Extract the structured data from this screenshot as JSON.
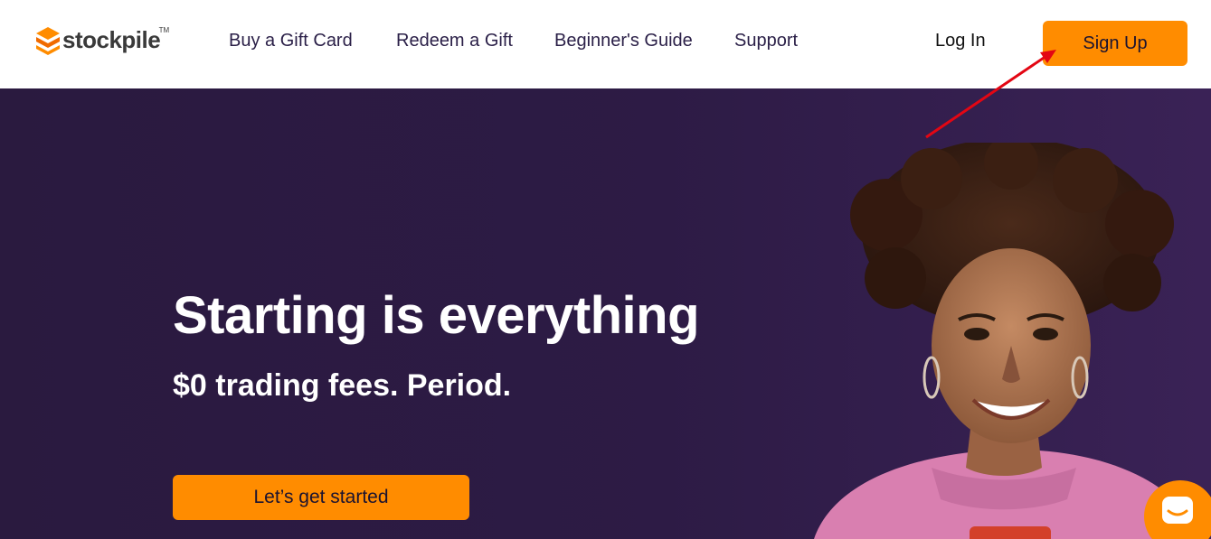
{
  "brand": {
    "name": "stockpile",
    "trademark": "TM",
    "accent_color": "#ff8c00",
    "hero_bg": "#2d1b45"
  },
  "nav": {
    "items": [
      {
        "label": "Buy a Gift Card"
      },
      {
        "label": "Redeem a Gift"
      },
      {
        "label": "Beginner's Guide"
      },
      {
        "label": "Support"
      }
    ],
    "login_label": "Log In",
    "signup_label": "Sign Up"
  },
  "hero": {
    "title": "Starting is everything",
    "subtitle": "$0 trading fees. Period.",
    "cta_label": "Let’s get started"
  },
  "icons": {
    "logo": "stockpile-logo-icon",
    "chat": "chat-icon",
    "annotation": "red-arrow-annotation"
  }
}
